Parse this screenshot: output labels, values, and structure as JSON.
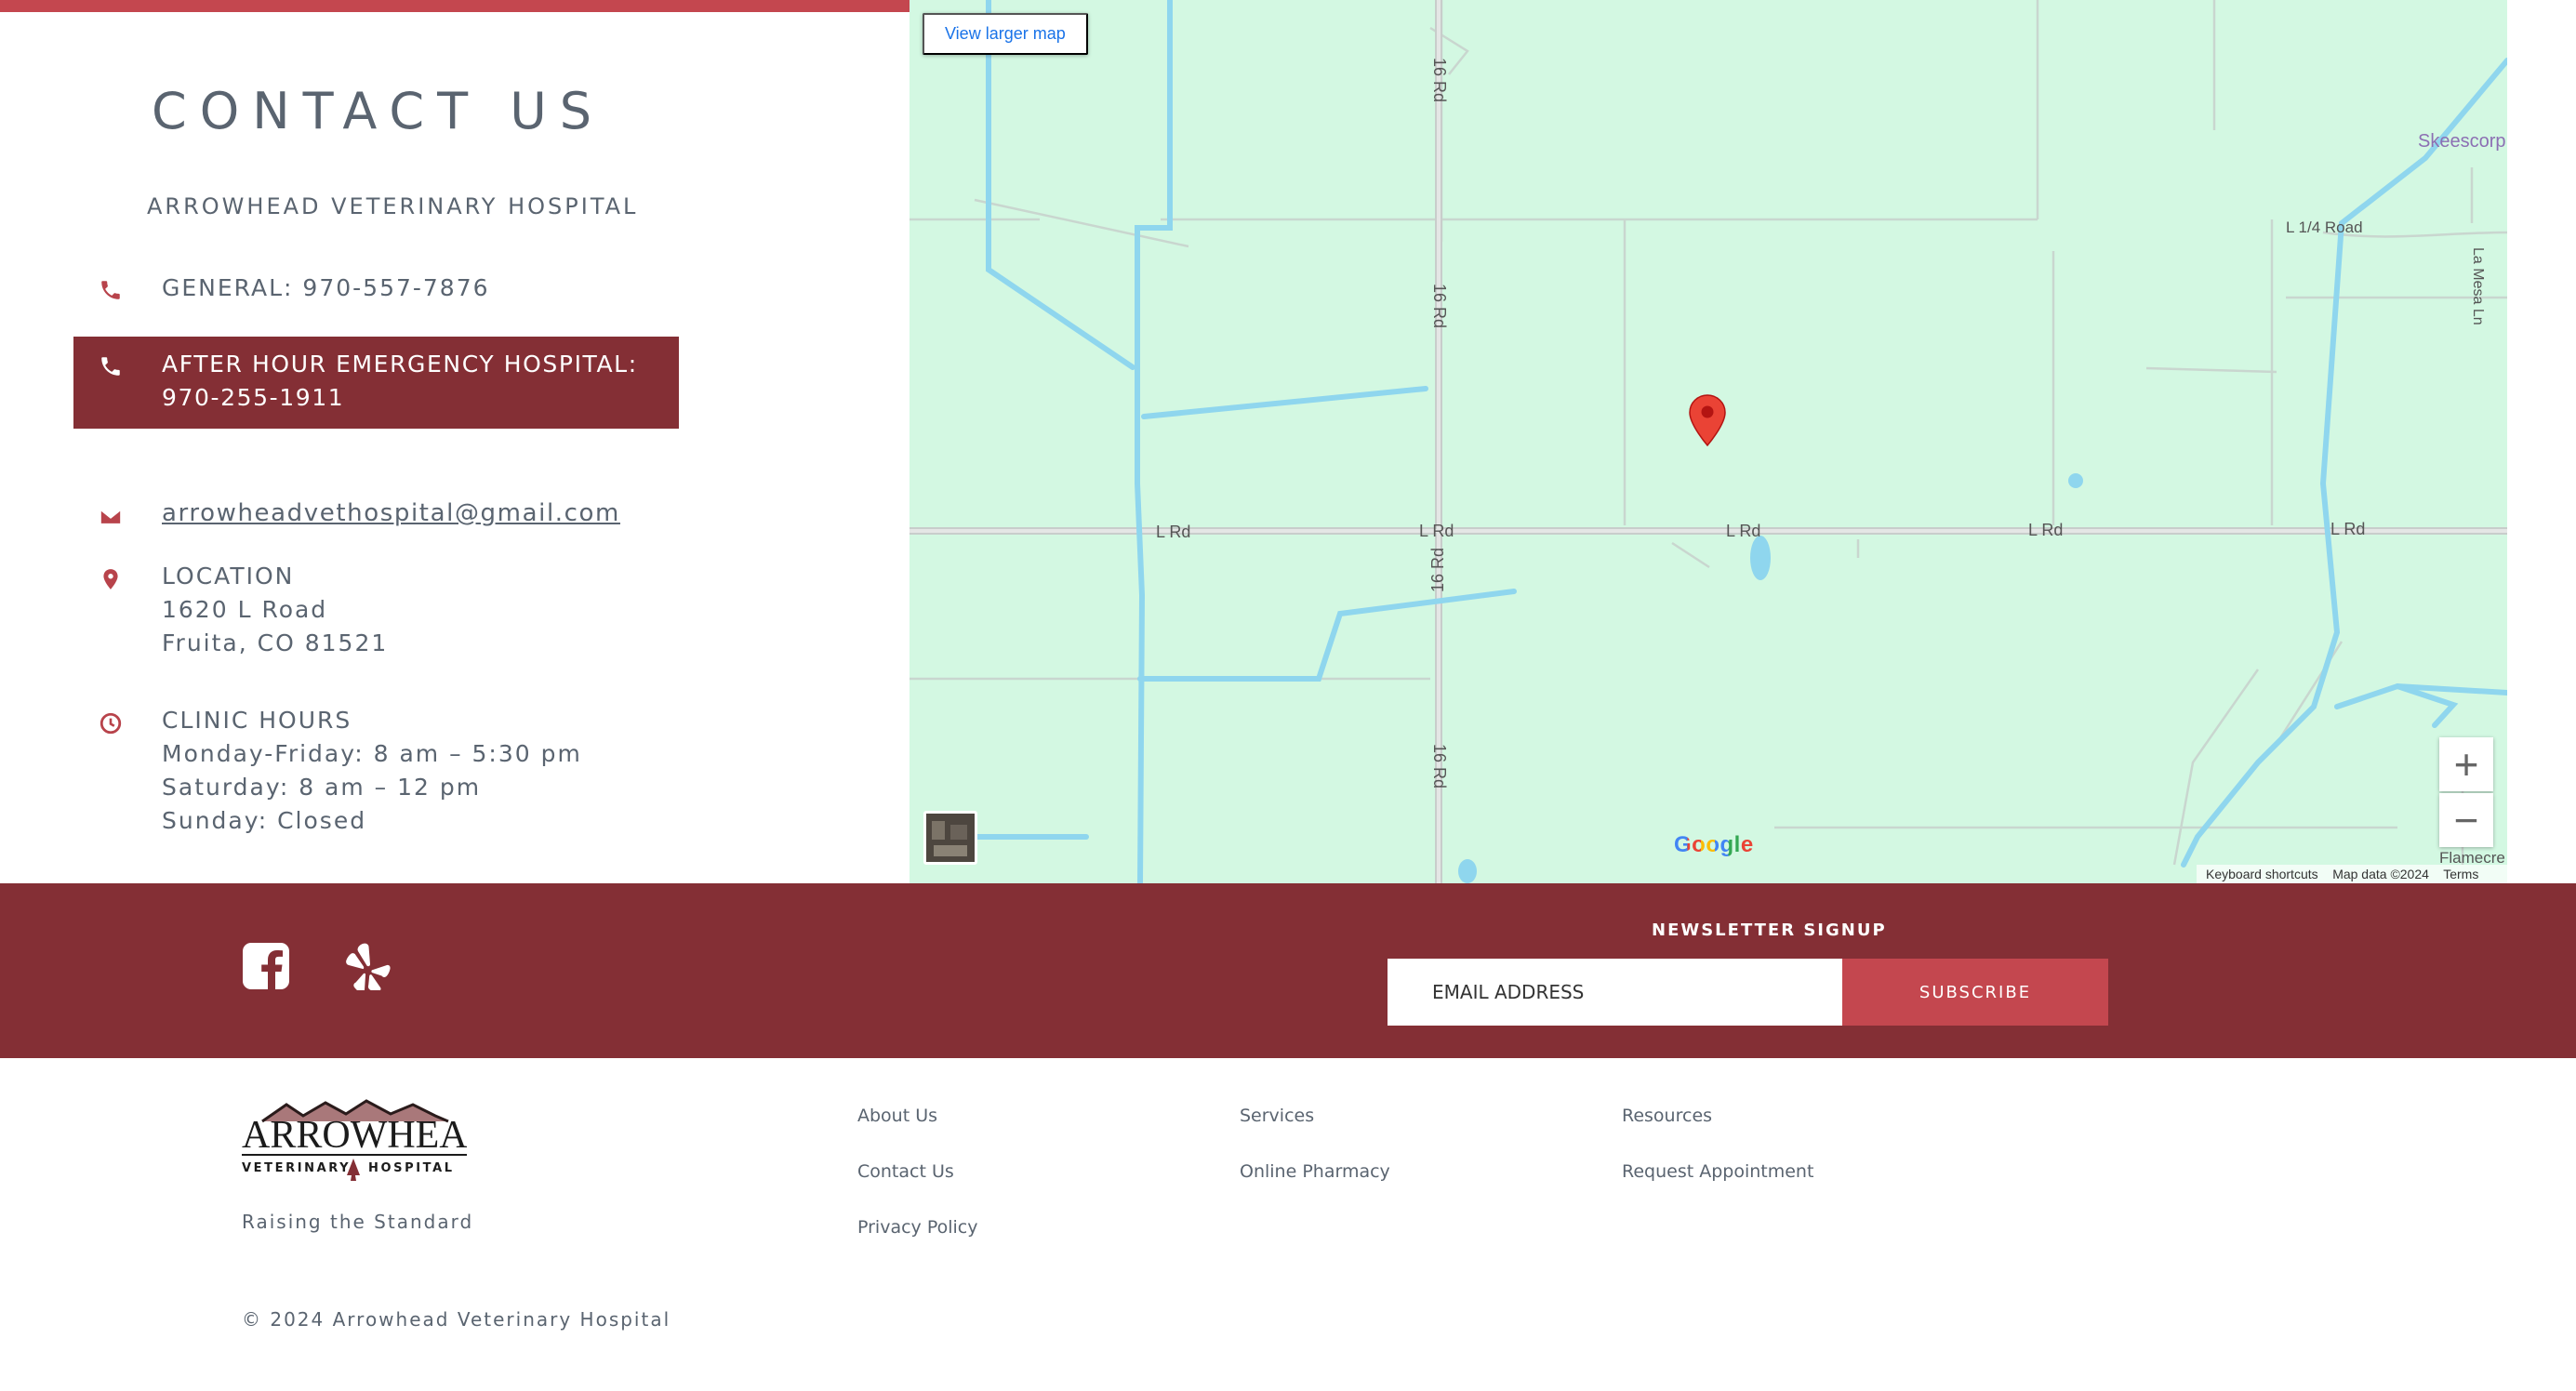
{
  "colors": {
    "accent": "#c4474f",
    "band": "#842f35",
    "map_bg": "#d3f8e2",
    "text": "#5a6470"
  },
  "contact": {
    "title": "CONTACT US",
    "hospital_name": "ARROWHEAD VETERINARY HOSPITAL",
    "general": "GENERAL: 970-557-7876",
    "emergency_line1": "AFTER HOUR EMERGENCY HOSPITAL:",
    "emergency_line2": "970-255-1911",
    "email": "arrowheadvethospital@gmail.com",
    "location": {
      "label": "LOCATION",
      "street": "1620 L Road",
      "city": "Fruita, CO 81521"
    },
    "hours": {
      "label": "CLINIC HOURS",
      "weekdays": "Monday-Friday: 8 am – 5:30 pm",
      "saturday": "Saturday: 8 am – 12 pm",
      "sunday": "Sunday: Closed"
    }
  },
  "map": {
    "larger_map": "View larger map",
    "zoom_in": "+",
    "zoom_out": "−",
    "google": "Google",
    "keyboard_shortcuts": "Keyboard shortcuts",
    "map_data": "Map data ©2024",
    "terms": "Terms",
    "labels": {
      "rd16_a": "16 Rd",
      "rd16_b": "16 Rd",
      "rd16_c": "16 Rd",
      "rd16_d": "16 Rd",
      "l_rd_1": "L Rd",
      "l_rd_2": "L Rd",
      "l_rd_3": "L Rd",
      "l_rd_4": "L Rd",
      "l_rd_5": "L Rd",
      "l_quarter_rd": "L 1/4 Road",
      "la_mesa": "La Mesa Ln",
      "skeescorp": "Skeescorp",
      "flamecre": "Flamecre"
    }
  },
  "band": {
    "facebook_icon": "facebook-icon",
    "yelp_icon": "yelp-icon",
    "newsletter_title": "NEWSLETTER SIGNUP",
    "email_placeholder": "EMAIL ADDRESS",
    "subscribe_label": "SUBSCRIBE"
  },
  "footer": {
    "logo_top": "ARROWHEAD",
    "logo_bottom_left": "VETERINARY",
    "logo_bottom_right": "HOSPITAL",
    "tagline": "Raising the Standard",
    "links": {
      "about": "About Us",
      "contact": "Contact Us",
      "privacy": "Privacy Policy",
      "services": "Services",
      "pharmacy": "Online Pharmacy",
      "resources": "Resources",
      "appointment": "Request Appointment"
    },
    "copyright": "© 2024 Arrowhead Veterinary Hospital"
  }
}
